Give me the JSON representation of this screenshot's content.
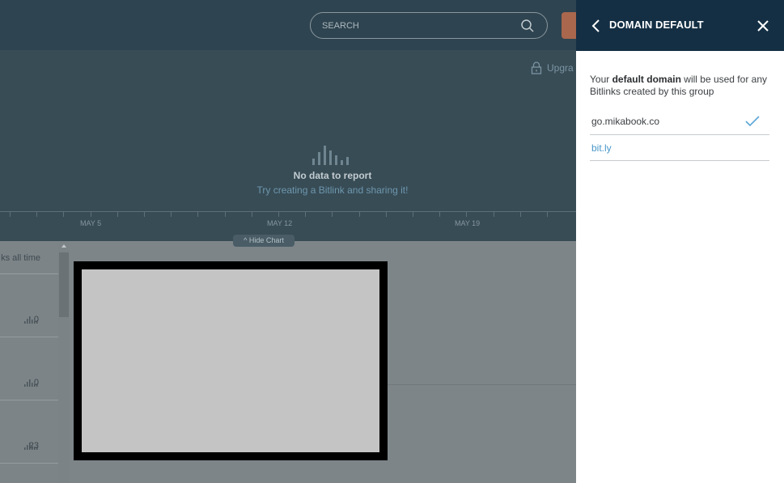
{
  "header": {
    "search_placeholder": "SEARCH",
    "upgrade_label": "Upgra"
  },
  "chart": {
    "no_data": "No data to report",
    "hint": "Try creating a Bitlink and sharing it!",
    "x_labels": [
      "MAY 5",
      "MAY 12",
      "MAY 19"
    ],
    "hide_chart_label": "^ Hide Chart"
  },
  "list": {
    "header": "ks all time",
    "rows": [
      {
        "clicks": "0"
      },
      {
        "clicks": "0"
      },
      {
        "clicks": "23"
      }
    ]
  },
  "panel": {
    "title": "DOMAIN DEFAULT",
    "desc_prefix": "Your ",
    "desc_bold": "default domain",
    "desc_suffix": " will be used for any Bitlinks created by this group",
    "domains": [
      {
        "name": "go.mikabook.co",
        "selected": true,
        "color": "#3b3f42"
      },
      {
        "name": "bit.ly",
        "selected": false,
        "color": "#4a97c9"
      }
    ]
  },
  "colors": {
    "accent_orange": "#a9674d",
    "panel_header": "#142f44",
    "link_blue": "#4a97c9",
    "check_blue": "#5ba7d6"
  }
}
